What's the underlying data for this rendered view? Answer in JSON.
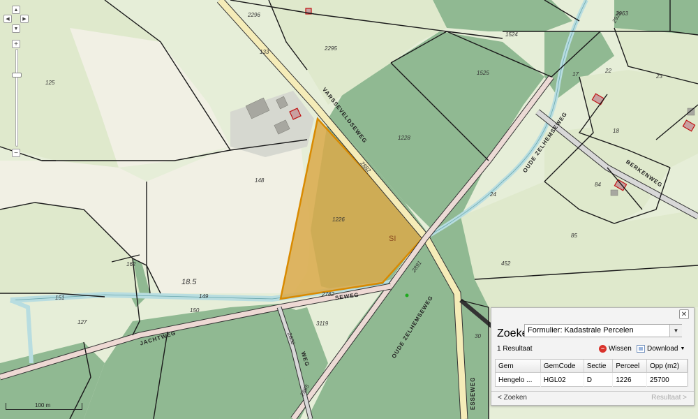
{
  "map": {
    "parcel_numbers": {
      "p2296": "2296",
      "p2963": "2963",
      "p1524": "1524",
      "p2295": "2295",
      "p133": "133",
      "p125": "125",
      "p1525": "1525",
      "p17": "17",
      "p22": "22",
      "p23": "23",
      "p18": "18",
      "p1228": "1228",
      "p148": "148",
      "p1226": "1226",
      "p84": "84",
      "p24": "24",
      "p85": "85",
      "p452": "452",
      "p162": "162",
      "p185": "18.5",
      "p151": "151",
      "p149": "149",
      "p150": "150",
      "p127": "127",
      "p3119": "3119",
      "p2782": "2782",
      "p2891": "2891",
      "p2882": "2882",
      "p30": "30",
      "p2926": "2926",
      "p2865": "2865",
      "p2806": "2806"
    },
    "road_names": {
      "varsseveldseweg": "VARSSEVELDSEWEG",
      "oude_zelhemseweg_upper": "OUDE ZELHEMSEWEG",
      "oude_zelhemseweg_lower": "OUDE ZELHEMSEWEG",
      "berkenweg": "BERKENWEG",
      "jachtweg": "JACHTWEG",
      "lower_road": "SEWEG",
      "small_road": "WEG",
      "bottom_road": "ESSEWEG"
    },
    "landuse_code": "SI",
    "scale_label": "100 m",
    "colors": {
      "forest": "#8fb890",
      "grass": "#dce8c8",
      "field": "#efefe3",
      "selected_parcel": "#d9a94a",
      "road_main": "#f5ecb8",
      "water": "#b8dde0"
    }
  },
  "controls": {
    "pan_up": "▲",
    "pan_left": "◀",
    "pan_right": "▶",
    "pan_down": "▼",
    "zoom_in": "+",
    "zoom_out": "−"
  },
  "panel": {
    "close": "✕",
    "search_label": "Zoeken:",
    "search_value": "Formulier: Kadastrale Percelen",
    "result_count": "1 Resultaat",
    "clear_label": "Wissen",
    "download_label": "Download",
    "columns": [
      "Gem",
      "GemCode",
      "Sectie",
      "Perceel",
      "Opp (m2)"
    ],
    "rows": [
      [
        "Hengelo ...",
        "HGL02",
        "D",
        "1226",
        "25700"
      ]
    ],
    "back_label": "< Zoeken",
    "next_label": "Resultaat >"
  }
}
